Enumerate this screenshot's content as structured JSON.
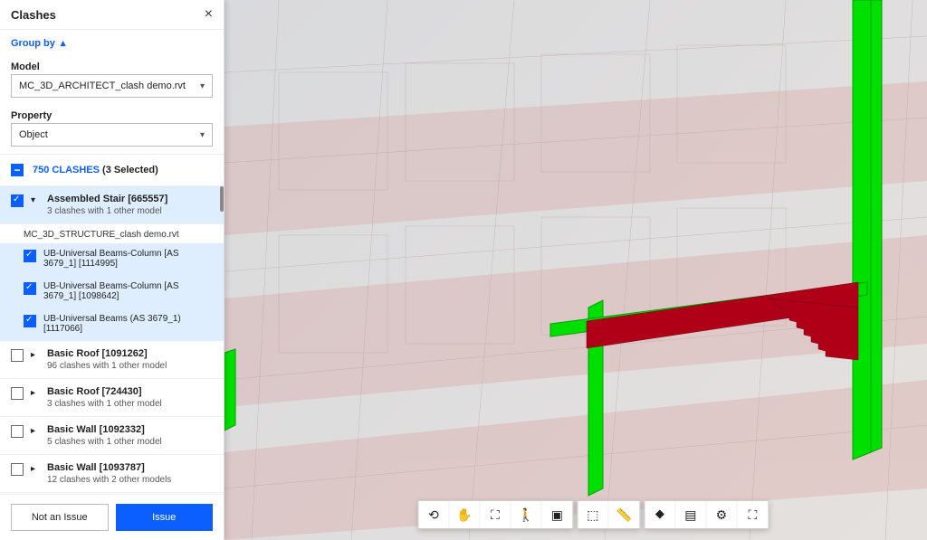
{
  "panel": {
    "title": "Clashes",
    "group_by_label": "Group by",
    "model_label": "Model",
    "model_value": "MC_3D_ARCHITECT_clash demo.rvt",
    "property_label": "Property",
    "property_value": "Object",
    "clash_count": "750 CLASHES",
    "selected_text": "(3 Selected)"
  },
  "groups": [
    {
      "title": "Assembled Stair [665557]",
      "sub": "3 clashes with 1 other model",
      "checked": true,
      "expanded": true,
      "selected": true,
      "sublabel": "MC_3D_STRUCTURE_clash demo.rvt"
    },
    {
      "title": "Basic Roof [1091262]",
      "sub": "96 clashes with 1 other model",
      "checked": false,
      "expander": "▸"
    },
    {
      "title": "Basic Roof [724430]",
      "sub": "3 clashes with 1 other model",
      "checked": false,
      "expander": "▸"
    },
    {
      "title": "Basic Wall [1092332]",
      "sub": "5 clashes with 1 other model",
      "checked": false,
      "expander": "▸"
    },
    {
      "title": "Basic Wall [1093787]",
      "sub": "12 clashes with 2 other models",
      "checked": false,
      "expander": "▸"
    }
  ],
  "children": [
    {
      "title": "UB-Universal Beams-Column [AS 3679_1] [1114995]"
    },
    {
      "title": "UB-Universal Beams-Column [AS 3679_1] [1098642]"
    },
    {
      "title": "UB-Universal Beams (AS 3679_1) [1117066]"
    }
  ],
  "footer": {
    "not_issue": "Not an Issue",
    "issue": "Issue"
  },
  "toolbar_icons": {
    "orbit": "⟲",
    "pan": "✋",
    "fit": "⛶",
    "walk": "🚶",
    "section": "▣",
    "cube": "⬚",
    "measure": "📏",
    "tree": "⯁",
    "sheets": "▤",
    "settings": "⚙",
    "fullscreen": "⛶"
  },
  "colors": {
    "accent": "#0b5fff",
    "clash_highlight": "#00ff00",
    "stair_clash": "#b00018"
  }
}
